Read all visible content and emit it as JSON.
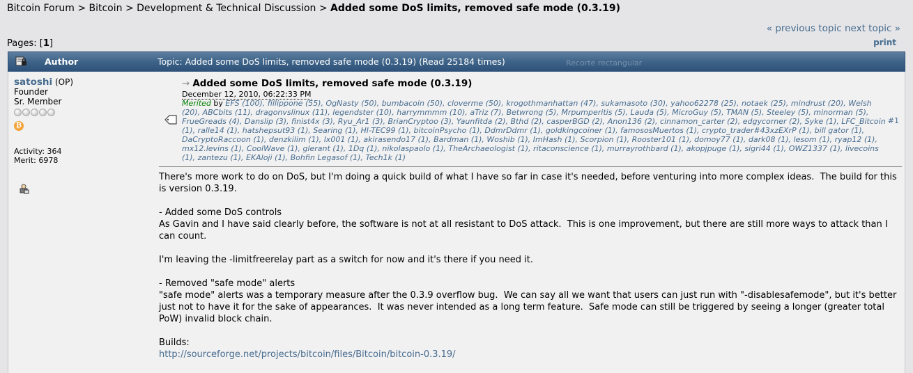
{
  "breadcrumb": {
    "items": [
      "Bitcoin Forum",
      "Bitcoin",
      "Development & Technical Discussion"
    ],
    "separator": ">",
    "current": "Added some DoS limits, removed safe mode (0.3.19)"
  },
  "nav": {
    "previous": "« previous topic",
    "next": "next topic »",
    "print": "print"
  },
  "pages": {
    "label": "Pages: [",
    "current": "1",
    "close": "]"
  },
  "header": {
    "author_label": "Author",
    "topic_text": "Topic: Added some DoS limits, removed safe mode (0.3.19)  (Read 25184 times)",
    "ghost_text": "Recorte rectangular"
  },
  "poster": {
    "name": "satoshi",
    "op": "(OP)",
    "title": "Founder",
    "rank": "Sr. Member",
    "activity": "Activity: 364",
    "merit": "Merit: 6978"
  },
  "post": {
    "subject": "Added some DoS limits, removed safe mode (0.3.19)",
    "date": "December 12, 2010, 06:22:33 PM",
    "number": "#1",
    "merited_label": "Merited",
    "merited_by": "by",
    "merits": "EFS (100), fillippone (55), OgNasty (50), bumbacoin (50), cloverme (50), krogothmanhattan (47), sukamasoto (30), yahoo62278 (25), notaek (25), mindrust (20), Welsh (20), ABCbits (11), dragonvslinux (11), legendster (10), harrymmmm (10), aTriz (7), Betwrong (5), Mrpumperitis (5), Lauda (5), MicroGuy (5), TMAN (5), Steeley (5), minorman (5), FrueGreads (4), Danslip (3), finist4x (3), Ryu_Ar1 (3), BrianCryptoo (3), Yaunfitda (2), Bthd (2), casperBGD (2), Anon136 (2), cinnamon_carter (2), edgycorner (2), Syke (1), LFC_Bitcoin (1), ralle14 (1), hatshepsut93 (1), Searing (1), HI-TEC99 (1), bitcoinPsycho (1), DdmrDdmr (1), goldkingcoiner (1), famososMuertos (1), crypto_trader#43xzEXrP (1), bill gator (1), DaCryptoRaccoon (1), denzkilim (1), lx001 (1), akirasendo17 (1), Bardman (1), Woshib (1), ImHash (1), Scorpion (1), Rooster101 (1), domoy77 (1), dark08 (1), lesom (1), ryap12 (1), mx12.levins (1), CoolWave (1), glerant (1), 1Dq (1), nikolaspaolo (1), TheArchaeologist (1), ritaconscience (1), murrayrothbard (1), akopjpuge (1), sigri44 (1), OWZ1337 (1), livecoins (1), zantezu (1), EKAloji (1), Bohfin Legasof (1), Tech1k (1)",
    "paragraphs": [
      "There's more work to do on DoS, but I'm doing a quick build of what I have so far in case it's needed, before venturing into more complex ideas.  The build for this is version 0.3.19.",
      "- Added some DoS controls\nAs Gavin and I have said clearly before, the software is not at all resistant to DoS attack.  This is one improvement, but there are still more ways to attack than I can count.",
      "I'm leaving the -limitfreerelay part as a switch for now and it's there if you need it.",
      "- Removed \"safe mode\" alerts\n\"safe mode\" alerts was a temporary measure after the 0.3.9 overflow bug.  We can say all we want that users can just run with \"-disablesafemode\", but it's better just not to have it for the sake of appearances.  It was never intended as a long term feature.  Safe mode can still be triggered by seeing a longer (greater total PoW) invalid block chain.",
      "Builds:"
    ],
    "link": "http://sourceforge.net/projects/bitcoin/files/Bitcoin/bitcoin-0.3.19/"
  }
}
